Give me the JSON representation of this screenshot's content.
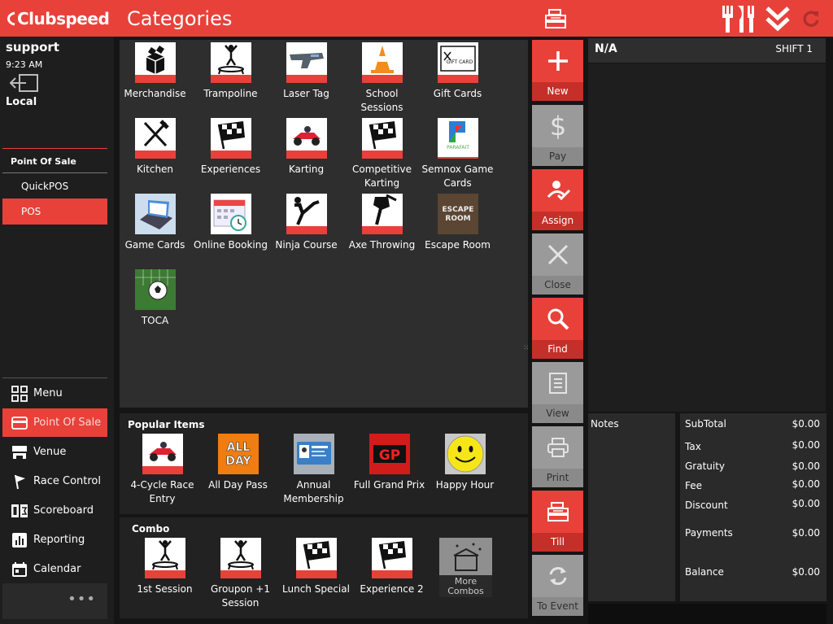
{
  "header": {
    "logo": "Clubspeed",
    "title": "Categories",
    "icons": [
      "cash-register-icon",
      "fork-knife-icon",
      "double-chevron-down-icon",
      "refresh-icon"
    ]
  },
  "user": {
    "name": "support",
    "time": "9:23 AM",
    "location": "Local"
  },
  "sidebar": {
    "section": "Point Of Sale",
    "items": [
      {
        "label": "QuickPOS",
        "active": false
      },
      {
        "label": "POS",
        "active": true
      }
    ],
    "nav": [
      {
        "label": "Menu",
        "icon": "grid-icon",
        "active": false
      },
      {
        "label": "Point Of Sale",
        "icon": "card-icon",
        "active": true
      },
      {
        "label": "Venue",
        "icon": "venue-icon",
        "active": false
      },
      {
        "label": "Race Control",
        "icon": "flag-icon",
        "active": false
      },
      {
        "label": "Scoreboard",
        "icon": "scoreboard-icon",
        "active": false
      },
      {
        "label": "Reporting",
        "icon": "chart-icon",
        "active": false
      },
      {
        "label": "Calendar",
        "icon": "calendar-icon",
        "active": false
      }
    ],
    "more": "•••"
  },
  "categories": [
    {
      "label": "Merchandise",
      "icon": "box-icon"
    },
    {
      "label": "Trampoline",
      "icon": "trampoline-icon"
    },
    {
      "label": "Laser Tag",
      "icon": "laser-gun-icon"
    },
    {
      "label": "School Sessions",
      "icon": "traffic-cone-icon"
    },
    {
      "label": "Gift Cards",
      "icon": "gift-card-icon",
      "text": "GIFT CARD"
    },
    {
      "label": "Kitchen",
      "icon": "fork-knife-icon"
    },
    {
      "label": "Experiences",
      "icon": "checkered-flag-icon"
    },
    {
      "label": "Karting",
      "icon": "kart-icon"
    },
    {
      "label": "Competitive Karting",
      "icon": "checkered-flag-icon"
    },
    {
      "label": "Semnox Game Cards",
      "icon": "parafait-logo-icon",
      "text": "PARAFAIT"
    },
    {
      "label": "Game Cards",
      "icon": "card-reader-icon"
    },
    {
      "label": "Online Booking",
      "icon": "calendar-clock-icon"
    },
    {
      "label": "Ninja Course",
      "icon": "ninja-icon"
    },
    {
      "label": "Axe Throwing",
      "icon": "axe-icon"
    },
    {
      "label": "Escape Room",
      "icon": "escape-room-icon",
      "text": "ESCAPE ROOM"
    },
    {
      "label": "TOCA",
      "icon": "soccer-ball-icon"
    }
  ],
  "popular": {
    "title": "Popular Items",
    "items": [
      {
        "label": "4-Cycle Race Entry",
        "icon": "kart-icon"
      },
      {
        "label": "All Day Pass",
        "icon": "all-day-icon",
        "text": "ALL DAY"
      },
      {
        "label": "Annual Membership",
        "icon": "membership-card-icon"
      },
      {
        "label": "Full Grand Prix",
        "icon": "gp-icon",
        "text": "GP"
      },
      {
        "label": "Happy Hour",
        "icon": "smiley-icon"
      }
    ]
  },
  "combo": {
    "title": "Combo",
    "items": [
      {
        "label": "1st Session",
        "icon": "trampoline-icon"
      },
      {
        "label": "Groupon +1 Session",
        "icon": "trampoline-icon"
      },
      {
        "label": "Lunch Special",
        "icon": "checkered-flag-icon"
      },
      {
        "label": "Experience 2",
        "icon": "checkered-flag-icon"
      },
      {
        "label": "More Combos",
        "icon": "more-combos-icon",
        "text": "More Combos"
      }
    ]
  },
  "actions": [
    {
      "label": "New",
      "icon": "plus-icon",
      "style": "red"
    },
    {
      "label": "Pay",
      "icon": "dollar-icon",
      "style": "grey"
    },
    {
      "label": "Assign",
      "icon": "assign-icon",
      "style": "red"
    },
    {
      "label": "Close",
      "icon": "close-icon",
      "style": "grey"
    },
    {
      "label": "Find",
      "icon": "search-icon",
      "style": "red"
    },
    {
      "label": "View",
      "icon": "document-icon",
      "style": "grey"
    },
    {
      "label": "Print",
      "icon": "printer-icon",
      "style": "grey"
    },
    {
      "label": "Till",
      "icon": "cash-register-icon",
      "style": "red"
    },
    {
      "label": "To Event",
      "icon": "sync-icon",
      "style": "grey"
    }
  ],
  "order": {
    "customer": "N/A",
    "shift": "SHIFT 1",
    "notes_label": "Notes",
    "totals": [
      {
        "label": "SubTotal",
        "value": "$0.00"
      },
      {
        "label": "Tax",
        "value": "$0.00"
      },
      {
        "label": "Gratuity",
        "value": "$0.00"
      },
      {
        "label": "Fee",
        "value": "$0.00"
      },
      {
        "label": "Discount",
        "value": "$0.00"
      },
      {
        "label": "Payments",
        "value": "$0.00"
      },
      {
        "label": "Balance",
        "value": "$0.00"
      }
    ]
  },
  "colors": {
    "accent": "#e8413a",
    "panel": "#2e2e2e",
    "grey_button": "#9a9a9a",
    "background": "#151515"
  }
}
